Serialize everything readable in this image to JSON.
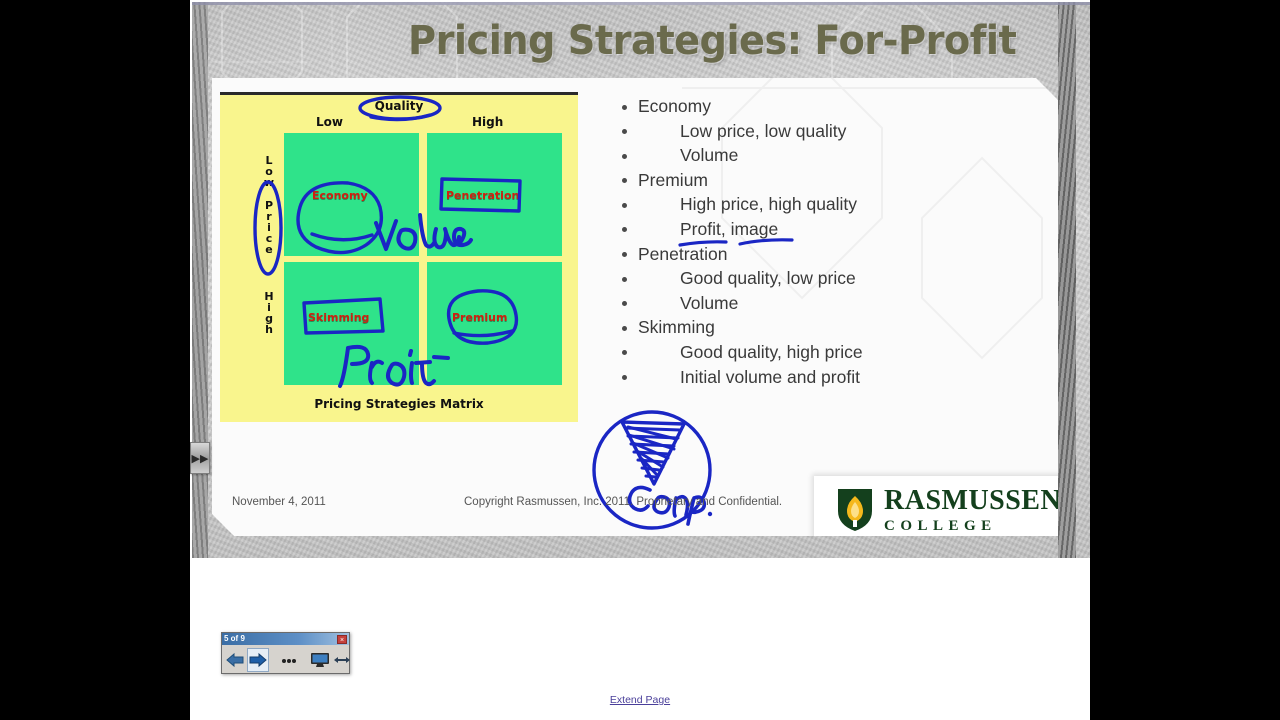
{
  "slide": {
    "title": "Pricing Strategies: For-Profit",
    "footer_date": "November 4, 2011",
    "footer_copyright": "Copyright Rasmussen, Inc. 2011. Proprietary and Confidential.",
    "logo": {
      "name": "RASMUSSEN",
      "sub": "COLLEGE",
      "shield_color": "#14401d",
      "flame_color": "#f5b81c"
    },
    "title_color": "#6a6a4c",
    "background_color": "#c6c6c6"
  },
  "matrix": {
    "caption": "Pricing Strategies Matrix",
    "axis_top_title": "Quality",
    "axis_top_low": "Low",
    "axis_top_high": "High",
    "axis_left_low": "Low",
    "axis_left_title": "Price",
    "axis_left_high": "High",
    "quadrants": [
      {
        "label": "Economy",
        "position": "top-left"
      },
      {
        "label": "Penetration",
        "position": "top-right"
      },
      {
        "label": "Skimming",
        "position": "bottom-left"
      },
      {
        "label": "Premium",
        "position": "bottom-right"
      }
    ],
    "annotations": [
      {
        "text": "Volume",
        "kind": "handwriting"
      },
      {
        "text": "Profit",
        "kind": "handwriting"
      }
    ],
    "colors": {
      "background": "#f9f58d",
      "quadrant": "#2fe38a",
      "label": "#d02010",
      "ink": "#1a26c4"
    }
  },
  "bullets": [
    {
      "text": "Economy",
      "level": 0,
      "underlined": false
    },
    {
      "text": "Low price, low quality",
      "level": 1,
      "underlined": false
    },
    {
      "text": "Volume",
      "level": 1,
      "underlined": false
    },
    {
      "text": "Premium",
      "level": 0,
      "underlined": false
    },
    {
      "text": "High price, high quality",
      "level": 1,
      "underlined": false
    },
    {
      "text": "Profit, image",
      "level": 1,
      "underlined": true
    },
    {
      "text": "Penetration",
      "level": 0,
      "underlined": false
    },
    {
      "text": "Good quality, low price",
      "level": 1,
      "underlined": false
    },
    {
      "text": "Volume",
      "level": 1,
      "underlined": false
    },
    {
      "text": "Skimming",
      "level": 0,
      "underlined": false
    },
    {
      "text": "Good quality, high price",
      "level": 1,
      "underlined": false
    },
    {
      "text": "Initial volume and profit",
      "level": 1,
      "underlined": false
    }
  ],
  "ink_annotation": {
    "label": "Conp.",
    "shape": "circle-with-pie-wedge",
    "color": "#1a26c4"
  },
  "expander": {
    "glyph": "▶▶",
    "name": "expand-panel"
  },
  "nav_window": {
    "title": "5 of 9",
    "close_label": "×",
    "buttons": [
      {
        "name": "back-button",
        "glyph": "←"
      },
      {
        "name": "forward-button",
        "glyph": "→"
      },
      {
        "name": "more-button",
        "glyph": "•••"
      },
      {
        "name": "screen-button",
        "glyph": "▣"
      },
      {
        "name": "resize-button",
        "glyph": "↔"
      }
    ]
  },
  "extend_page": {
    "label": "Extend Page"
  }
}
